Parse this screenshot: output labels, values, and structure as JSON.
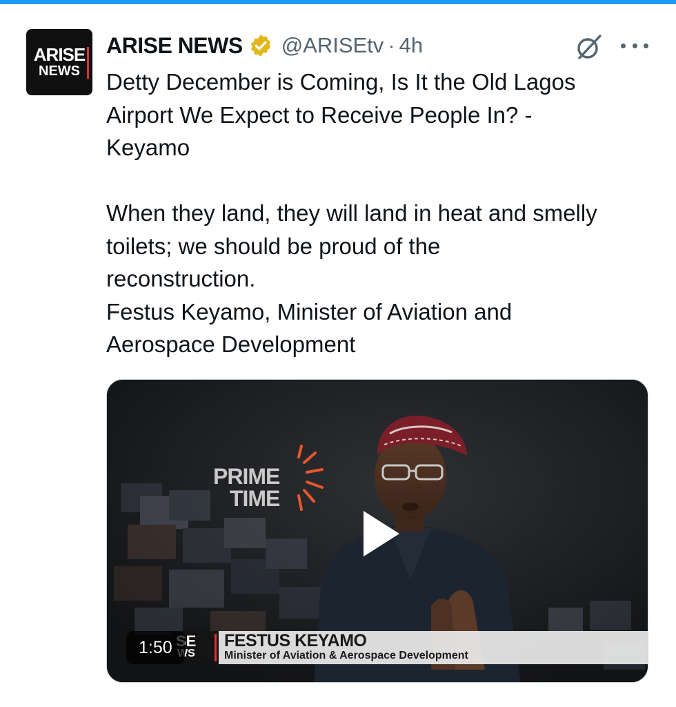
{
  "tweet": {
    "author_name": "ARISE NEWS",
    "handle": "@ARISEtv",
    "separator": "·",
    "time": "4h",
    "verified": true,
    "avatar_line1": "ARISE",
    "avatar_line2": "NEWS",
    "text": "Detty December is Coming, Is It the Old Lagos\nAirport We Expect to Receive People In? -\nKeyamo\n\nWhen they land, they will land in heat and smelly\ntoilets; we should be proud of the\nreconstruction.\nFestus Keyamo, Minister of Aviation and\nAerospace Development"
  },
  "icons": {
    "verified_badge": "verified-gold-badge-icon",
    "grok": "grok-icon",
    "more": "more-options-icon",
    "play": "play-icon"
  },
  "video": {
    "duration": "1:50",
    "studio_text_line1": "PRIME",
    "studio_text_line2": "TIME",
    "lower_third_logo_top": "SE",
    "lower_third_logo_bottom": "WS",
    "lower_third_name": "FESTUS KEYAMO",
    "lower_third_title": "Minister of Aviation & Aerospace Development"
  },
  "colors": {
    "accent": "#1d9bf0",
    "badge_gold": "#e2b719",
    "secondary_text": "#536471",
    "arise_red": "#e03131"
  }
}
